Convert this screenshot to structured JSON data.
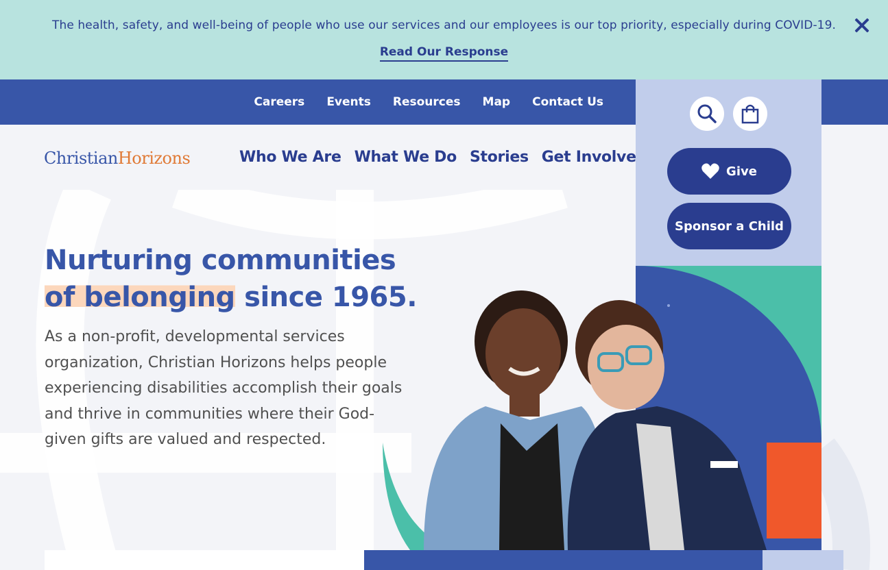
{
  "alert": {
    "message": "The health, safety, and well-being of people who use our services and our employees is our top priority, especially during COVID-19.",
    "link_label": "Read Our Response",
    "close_icon": "close-icon"
  },
  "utility_nav": {
    "items": [
      {
        "label": "Careers"
      },
      {
        "label": "Events"
      },
      {
        "label": "Resources"
      },
      {
        "label": "Map"
      },
      {
        "label": "Contact Us"
      }
    ]
  },
  "logo": {
    "part1": "Christian",
    "part2": "Horizons"
  },
  "primary_nav": {
    "items": [
      {
        "label": "Who We Are"
      },
      {
        "label": "What We Do"
      },
      {
        "label": "Stories"
      },
      {
        "label": "Get Involved"
      }
    ]
  },
  "actions": {
    "search_icon": "search-icon",
    "cart_icon": "shopping-bag-icon",
    "give_label": "Give",
    "give_icon": "heart-icon",
    "sponsor_label": "Sponsor a Child"
  },
  "hero": {
    "title_line1": "Nurturing communities",
    "title_highlight": "of belonging",
    "title_rest": " since 1965.",
    "description": "As a non-profit, developmental services organization, Christian Horizons helps people experiencing disabilities accomplish their goals and thrive in communities where their God-given gifts are valued and respected."
  },
  "colors": {
    "alert_bg": "#b8e3df",
    "primary_blue": "#3856a8",
    "dark_blue": "#2a3d8f",
    "panel_blue": "#c1cdeb",
    "teal": "#4bbfa9",
    "orange": "#f0582b",
    "highlight": "#fcd7bc"
  }
}
